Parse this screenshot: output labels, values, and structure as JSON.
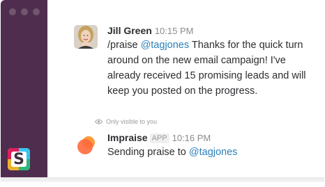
{
  "colors": {
    "sidebar": "#4f2d4f",
    "mention": "#2a80b9",
    "impraise_orange": "#ff6a3d"
  },
  "sidebar": {
    "window_controls": [
      "dot",
      "dot",
      "dot"
    ],
    "logo_letter": "S"
  },
  "messages": [
    {
      "author": "Jill Green",
      "time": "10:15 PM",
      "avatar_icon": "user-photo-avatar",
      "command": "/praise ",
      "mention": "@tagjones",
      "text": " Thanks for the quick turn around on the new email campaign! I've already received 15 promising leads and will keep you posted on the progress."
    },
    {
      "visibility_note": "Only visible to you",
      "author": "Impraise",
      "badge": "APP",
      "time": "10:16 PM",
      "avatar_icon": "impraise-logo",
      "text": "Sending praise to ",
      "mention": "@tagjones"
    }
  ]
}
